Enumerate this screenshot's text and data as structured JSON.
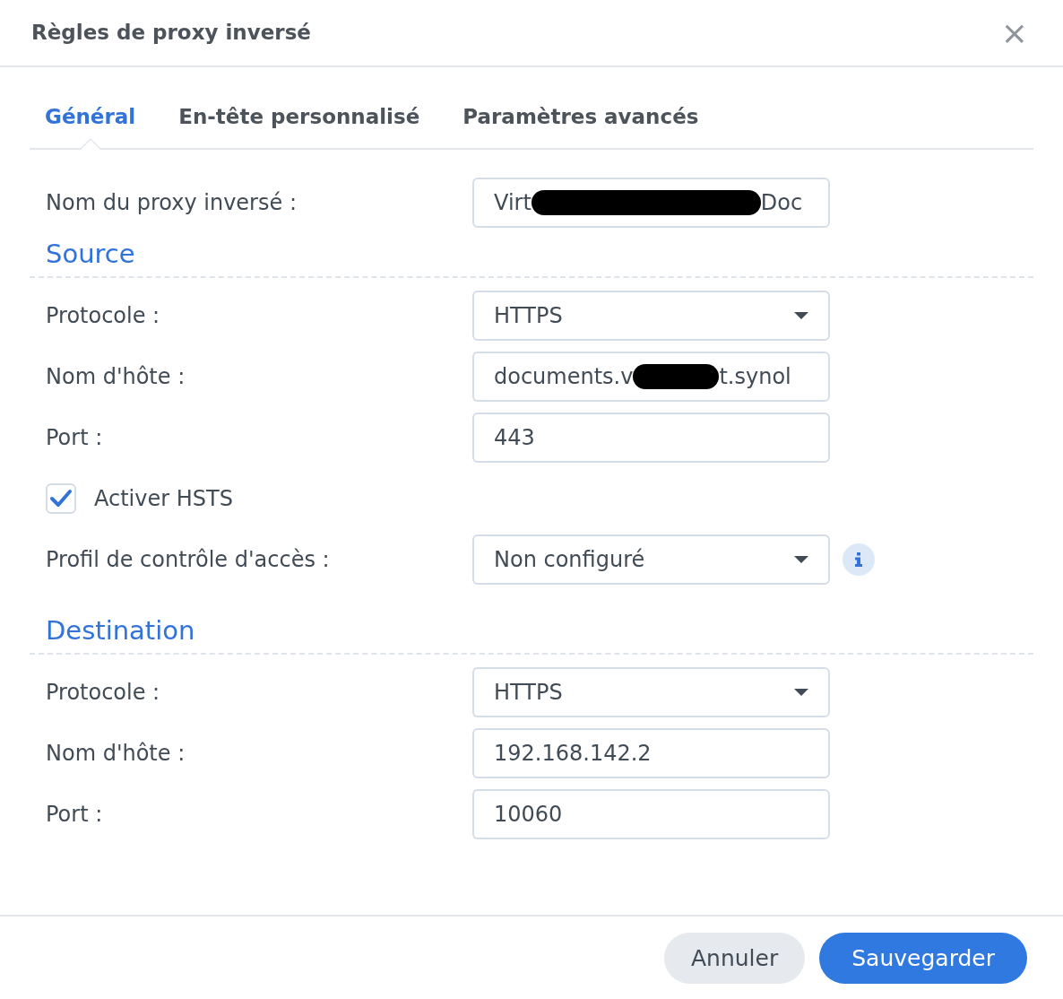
{
  "window": {
    "title": "Règles de proxy inversé",
    "close": "×"
  },
  "tabs": [
    {
      "label": "Général",
      "selected": true
    },
    {
      "label": "En-tête personnalisé",
      "selected": false
    },
    {
      "label": "Paramètres avancés",
      "selected": false
    }
  ],
  "rows": [
    {
      "kind": "text",
      "label": "Nom du proxy inversé :",
      "value_parts": [
        "Virt",
        "Doc"
      ],
      "redacted": true
    },
    {
      "kind": "heading",
      "label": "Source"
    },
    {
      "kind": "select",
      "label": "Protocole :",
      "value": "HTTPS"
    },
    {
      "kind": "text",
      "label": "Nom d'hôte :",
      "value_parts": [
        "documents.v",
        "t.synol"
      ],
      "redacted": true
    },
    {
      "kind": "text",
      "label": "Port :",
      "value_parts": [
        "443"
      ]
    },
    {
      "kind": "checkbox",
      "label": "Activer HSTS",
      "checked": true
    },
    {
      "kind": "select",
      "label": "Profil de contrôle d'accès :",
      "value": "Non configuré",
      "info": true
    },
    {
      "kind": "heading",
      "label": "Destination"
    },
    {
      "kind": "select",
      "label": "Protocole :",
      "value": "HTTPS"
    },
    {
      "kind": "text",
      "label": "Nom d'hôte :",
      "value_parts": [
        "192.168.142.2"
      ]
    },
    {
      "kind": "text",
      "label": "Port :",
      "value_parts": [
        "10060"
      ]
    }
  ],
  "buttons": [
    {
      "label": "Annuler",
      "primary": false
    },
    {
      "label": "Sauvegarder",
      "primary": true
    }
  ]
}
